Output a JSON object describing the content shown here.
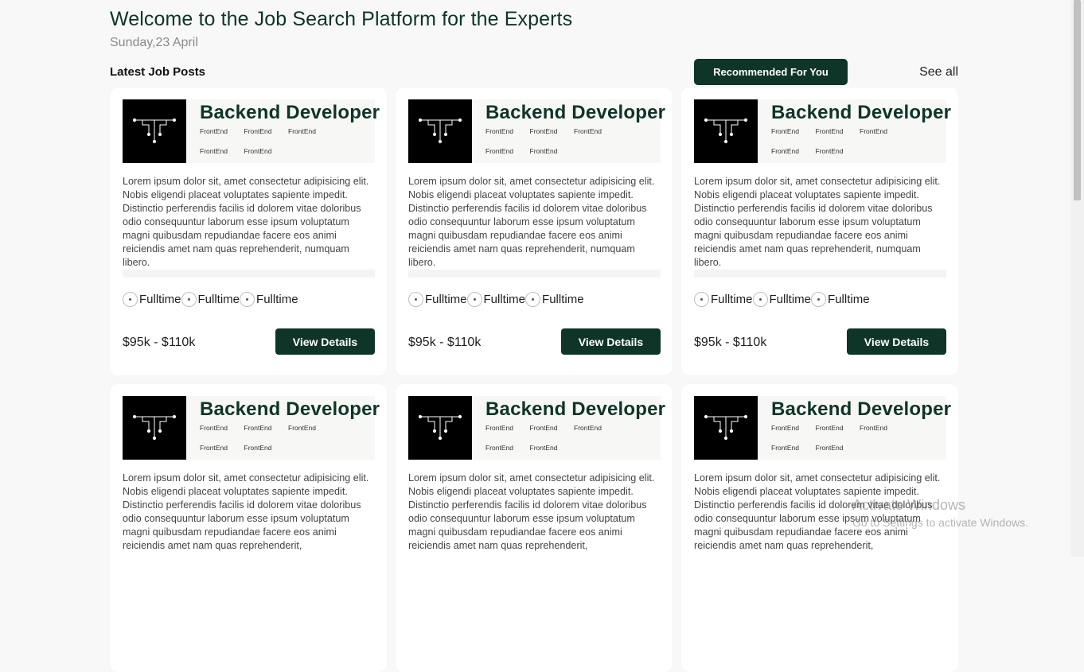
{
  "header": {
    "title": "Welcome to the Job Search Platform for the Experts",
    "date": "Sunday,23 April"
  },
  "section": {
    "title": "Latest Job Posts",
    "recommended_label": "Recommended For You",
    "see_all_label": "See all"
  },
  "jobs": [
    {
      "title": "Backend Developer",
      "tags": [
        "FrontEnd",
        "FrontEnd",
        "FrontEnd",
        "FrontEnd",
        "FrontEnd"
      ],
      "description": "Lorem ipsum dolor sit, amet consectetur adipisicing elit. Nobis eligendi placeat voluptates sapiente impedit. Distinctio perferendis facilis id dolorem vitae doloribus odio consequuntur laborum esse ipsum voluptatum magni quibusdam repudiandae facere eos animi reiciendis amet nam quas reprehenderit, numquam libero.",
      "types": [
        "Fulltime",
        "Fulltime",
        "Fulltime"
      ],
      "salary": "$95k - $110k",
      "button_label": "View Details"
    },
    {
      "title": "Backend Developer",
      "tags": [
        "FrontEnd",
        "FrontEnd",
        "FrontEnd",
        "FrontEnd",
        "FrontEnd"
      ],
      "description": "Lorem ipsum dolor sit, amet consectetur adipisicing elit. Nobis eligendi placeat voluptates sapiente impedit. Distinctio perferendis facilis id dolorem vitae doloribus odio consequuntur laborum esse ipsum voluptatum magni quibusdam repudiandae facere eos animi reiciendis amet nam quas reprehenderit, numquam libero.",
      "types": [
        "Fulltime",
        "Fulltime",
        "Fulltime"
      ],
      "salary": "$95k - $110k",
      "button_label": "View Details"
    },
    {
      "title": "Backend Developer",
      "tags": [
        "FrontEnd",
        "FrontEnd",
        "FrontEnd",
        "FrontEnd",
        "FrontEnd"
      ],
      "description": "Lorem ipsum dolor sit, amet consectetur adipisicing elit. Nobis eligendi placeat voluptates sapiente impedit. Distinctio perferendis facilis id dolorem vitae doloribus odio consequuntur laborum esse ipsum voluptatum magni quibusdam repudiandae facere eos animi reiciendis amet nam quas reprehenderit, numquam libero.",
      "types": [
        "Fulltime",
        "Fulltime",
        "Fulltime"
      ],
      "salary": "$95k - $110k",
      "button_label": "View Details"
    },
    {
      "title": "Backend Developer",
      "tags": [
        "FrontEnd",
        "FrontEnd",
        "FrontEnd",
        "FrontEnd",
        "FrontEnd"
      ],
      "description": "Lorem ipsum dolor sit, amet consectetur adipisicing elit. Nobis eligendi placeat voluptates sapiente impedit. Distinctio perferendis facilis id dolorem vitae doloribus odio consequuntur laborum esse ipsum voluptatum magni quibusdam repudiandae facere eos animi reiciendis amet nam quas reprehenderit,",
      "types": [],
      "salary": "",
      "button_label": ""
    },
    {
      "title": "Backend Developer",
      "tags": [
        "FrontEnd",
        "FrontEnd",
        "FrontEnd",
        "FrontEnd",
        "FrontEnd"
      ],
      "description": "Lorem ipsum dolor sit, amet consectetur adipisicing elit. Nobis eligendi placeat voluptates sapiente impedit. Distinctio perferendis facilis id dolorem vitae doloribus odio consequuntur laborum esse ipsum voluptatum magni quibusdam repudiandae facere eos animi reiciendis amet nam quas reprehenderit,",
      "types": [],
      "salary": "",
      "button_label": ""
    },
    {
      "title": "Backend Developer",
      "tags": [
        "FrontEnd",
        "FrontEnd",
        "FrontEnd",
        "FrontEnd",
        "FrontEnd"
      ],
      "description": "Lorem ipsum dolor sit, amet consectetur adipisicing elit. Nobis eligendi placeat voluptates sapiente impedit. Distinctio perferendis facilis id dolorem vitae doloribus odio consequuntur laborum esse ipsum voluptatum magni quibusdam repudiandae facere eos animi reiciendis amet nam quas reprehenderit,",
      "types": [],
      "salary": "",
      "button_label": ""
    }
  ],
  "icons": {
    "logo": "circuit-t-logo-icon",
    "type": "radio-dot-icon"
  },
  "colors": {
    "brand": "#0e3527",
    "page_bg": "#f8f8f8",
    "card_bg": "#ffffff",
    "logo_bg": "#000000"
  },
  "watermark": {
    "line1": "Activate Windows",
    "line2": "Go to Settings to activate Windows."
  }
}
